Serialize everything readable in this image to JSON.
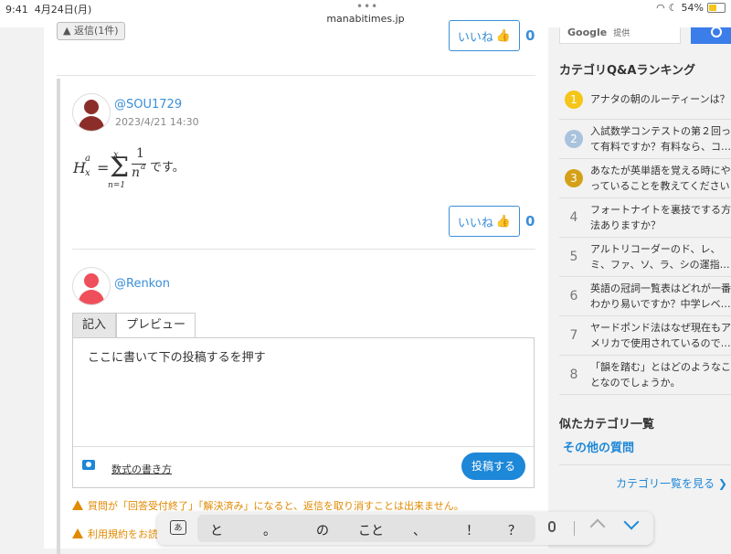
{
  "status": {
    "time": "9:41",
    "date": "4月24日(月)",
    "url": "manabitimes.jp",
    "battery": "54%"
  },
  "thread": {
    "reply_count_label": "▲ 返信(1件)",
    "like_label": "いいね",
    "like_count_top": "0",
    "like_count_mid": "0"
  },
  "comment": {
    "username": "@SOU1729",
    "date": "2023/4/21 14:30",
    "formula": {
      "H": "H",
      "sup": "a",
      "sub": "x",
      "eq": "=",
      "sum": "Σ",
      "upper": "x",
      "lower": "n=1",
      "num": "1",
      "den": "n",
      "den_sup": "a",
      "suffix": "です。"
    }
  },
  "reply_form": {
    "username": "@Renkon",
    "tab_input": "記入",
    "tab_preview": "プレビュー",
    "placeholder": "ここに書いて下の投稿するを押す",
    "howto_link": "数式の書き方",
    "post_button": "投稿する",
    "warning1": "質問が「回答受付終了」「解決済み」になると、返信を取り消すことは出来ません。",
    "warning2": "利用規約をお読"
  },
  "sidebar": {
    "search_brand": "Google",
    "search_sub": "提供",
    "ranking_title": "カテゴリQ&Aランキング",
    "ranking": [
      {
        "num": "1",
        "text": "アナタの朝のルーティーンは？",
        "color": "#f5c518"
      },
      {
        "num": "2",
        "text": "入試数学コンテストの第２回って有料ですか？有料なら、コ…",
        "color": "#a9c3dc"
      },
      {
        "num": "3",
        "text": "あなたが英単語を覚える時にやっていることを教えてください",
        "color": "#d4a017"
      },
      {
        "num": "4",
        "text": "フォートナイトを裏技でする方法ありますか？",
        "color": ""
      },
      {
        "num": "5",
        "text": "アルトリコーダーのド、レ、ミ、ファ、ソ、ラ、シの運指…",
        "color": ""
      },
      {
        "num": "6",
        "text": "英語の冠詞一覧表はどれが一番わかり易いですか？中学レベ…",
        "color": ""
      },
      {
        "num": "7",
        "text": "ヤードポンド法はなぜ現在もアメリカで使用されているので…",
        "color": ""
      },
      {
        "num": "8",
        "text": "「韻を踏む」とはどのようなことなのでしょうか。",
        "color": ""
      }
    ],
    "similar_title": "似たカテゴリ一覧",
    "other_questions": "その他の質問",
    "category_link": "カテゴリ一覧を見る ❯"
  },
  "keyboard": {
    "mode_key": "あ",
    "suggestions": [
      "と",
      "。",
      "の",
      "こと",
      "、",
      "！",
      "？"
    ]
  }
}
